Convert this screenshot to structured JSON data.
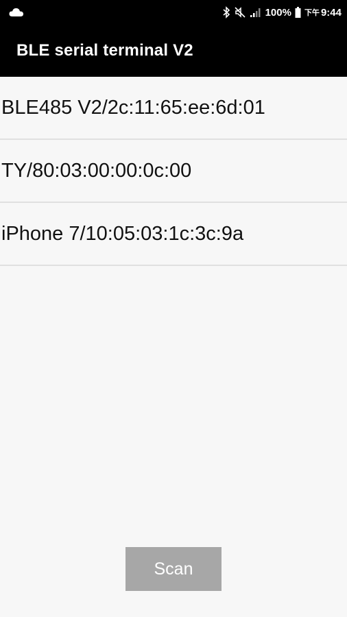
{
  "status_bar": {
    "battery_percent": "100%",
    "ampm": "下午",
    "time": "9:44",
    "icons": [
      "cloud-icon",
      "bluetooth-icon",
      "mute-icon",
      "signal-icon",
      "battery-icon"
    ]
  },
  "app_bar": {
    "title": "BLE serial terminal V2"
  },
  "devices": [
    {
      "label": "BLE485 V2/2c:11:65:ee:6d:01"
    },
    {
      "label": "TY/80:03:00:00:0c:00"
    },
    {
      "label": "iPhone 7/10:05:03:1c:3c:9a"
    }
  ],
  "scan_button": {
    "label": "Scan"
  },
  "colors": {
    "bar_background": "#000000",
    "list_background": "#f7f7f7",
    "divider": "#e0e0e0",
    "button_background": "#a7a7a7",
    "button_text": "#ffffff"
  }
}
